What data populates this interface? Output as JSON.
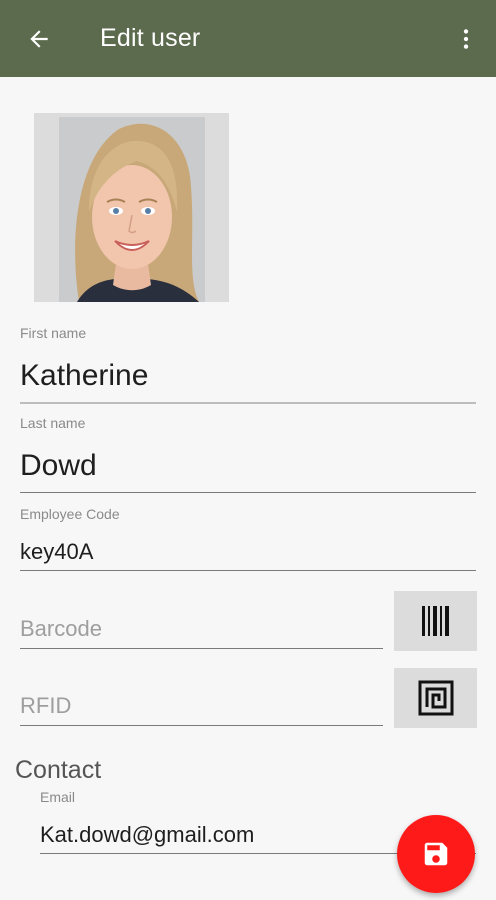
{
  "app_bar": {
    "title": "Edit user",
    "back_icon": "arrow-left-icon",
    "menu_icon": "more-vertical-icon",
    "color": "#5c6b4e"
  },
  "form": {
    "first_name": {
      "label": "First name",
      "value": "Katherine"
    },
    "last_name": {
      "label": "Last name",
      "value": "Dowd"
    },
    "employee_code": {
      "label": "Employee Code",
      "value": "key40A"
    },
    "barcode": {
      "placeholder": "Barcode",
      "scan_icon": "barcode-icon"
    },
    "rfid": {
      "placeholder": "RFID",
      "scan_icon": "rfid-icon"
    }
  },
  "contact": {
    "section_title": "Contact",
    "email": {
      "label": "Email",
      "value": "Kat.dowd@gmail.com"
    }
  },
  "fab": {
    "icon": "save-icon",
    "color": "#ff1a1a"
  }
}
